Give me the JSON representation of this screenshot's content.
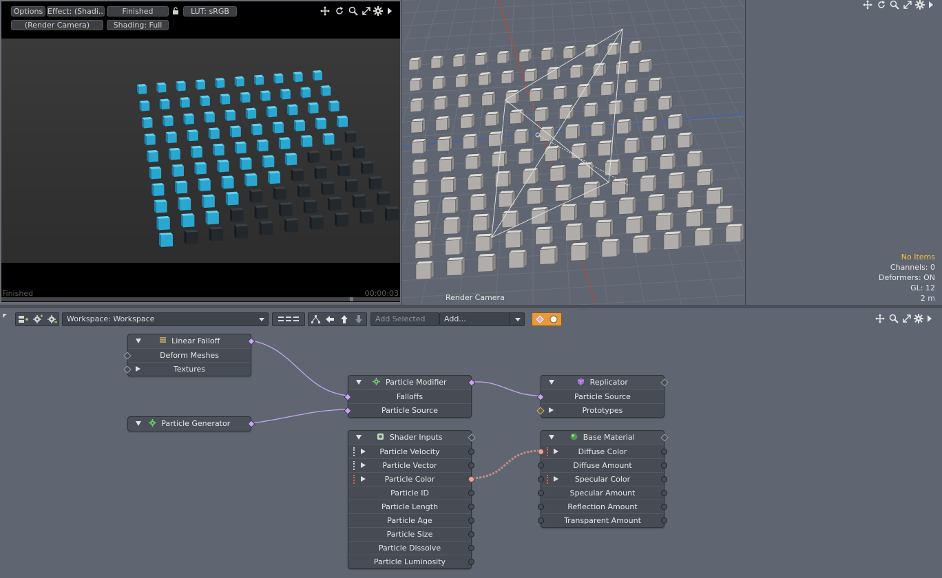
{
  "render": {
    "options_label": "Options",
    "effect_label": "Effect: (Shadi...",
    "status_label": "Finished",
    "lut_label": "LUT: sRGB",
    "camera_label": "(Render Camera)",
    "shading_label": "Shading: Full",
    "footer_status": "Finished",
    "footer_time": "00:00:03",
    "progress": 1.0,
    "toolbar_icons": [
      "move-icon",
      "refresh-icon",
      "zoom-icon",
      "maximize-icon",
      "gear-icon",
      "play-arrow-icon"
    ]
  },
  "viewport": {
    "camera_label": "Render Camera",
    "info": {
      "selection": "No Items",
      "channels": "Channels: 0",
      "deformers": "Deformers: ON",
      "gl": "GL: 12",
      "scale": "2 m"
    },
    "icons": [
      "move-icon",
      "rotate-icon",
      "zoom-icon",
      "maximize-icon",
      "gear-icon",
      "play-arrow-icon"
    ]
  },
  "schematic": {
    "workspace_label": "Workspace: Workspace",
    "add_selected_label": "Add Selected",
    "add_label": "Add...",
    "nodes": {
      "linear_falloff": {
        "title": "Linear Falloff",
        "rows": [
          "Deform Meshes",
          "Textures"
        ]
      },
      "particle_generator": {
        "title": "Particle Generator"
      },
      "particle_modifier": {
        "title": "Particle Modifier",
        "rows": [
          "Falloffs",
          "Particle Source"
        ]
      },
      "replicator": {
        "title": "Replicator",
        "rows": [
          "Particle Source",
          "Prototypes"
        ]
      },
      "shader_inputs": {
        "title": "Shader Inputs",
        "rows": [
          "Particle Velocity",
          "Particle Vector",
          "Particle Color",
          "Particle ID",
          "Particle Length",
          "Particle Age",
          "Particle Size",
          "Particle Dissolve",
          "Particle Luminosity"
        ]
      },
      "base_material": {
        "title": "Base Material",
        "rows": [
          "Diffuse Color",
          "Diffuse Amount",
          "Specular Color",
          "Specular Amount",
          "Reflection Amount",
          "Transparent Amount"
        ]
      }
    }
  },
  "colors": {
    "viewport_bg": "#5f6671",
    "link_purple": "#c9a6f0",
    "link_pink": "#e8a69a",
    "cube_blue": "#33b5dc",
    "cube_dark": "#2a2e33",
    "axis_red": "#c8442e",
    "axis_blue": "#3a5fcf",
    "info_yellow": "#f0c040"
  }
}
